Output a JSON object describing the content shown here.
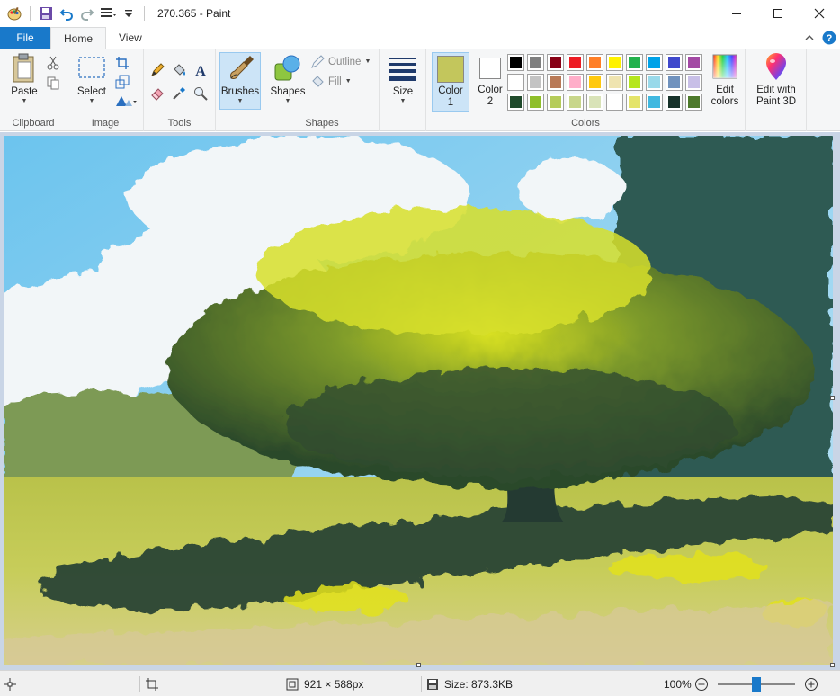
{
  "window": {
    "title": "270.365 - Paint"
  },
  "tabs": {
    "file": "File",
    "home": "Home",
    "view": "View"
  },
  "ribbon": {
    "clipboard": {
      "paste": "Paste",
      "group": "Clipboard"
    },
    "image": {
      "select": "Select",
      "group": "Image"
    },
    "tools": {
      "group": "Tools"
    },
    "shapes": {
      "shapes": "Shapes",
      "brushes": "Brushes",
      "outline": "Outline",
      "fill": "Fill",
      "group": "Shapes"
    },
    "size": {
      "label": "Size"
    },
    "colors": {
      "color1_line1": "Color",
      "color1_line2": "1",
      "color2_line1": "Color",
      "color2_line2": "2",
      "edit_line1": "Edit",
      "edit_line2": "colors",
      "group": "Colors",
      "color1_value": "#c3c65c",
      "color2_value": "#ffffff",
      "palette_row1": [
        "#000000",
        "#7f7f7f",
        "#880015",
        "#ed1c24",
        "#ff7f27",
        "#fff200",
        "#22b14c",
        "#00a2e8",
        "#3f48cc",
        "#a349a4"
      ],
      "palette_row2": [
        "#ffffff",
        "#c3c3c3",
        "#b97a57",
        "#ffaec9",
        "#ffc90e",
        "#efe4b0",
        "#b5e61d",
        "#99d9ea",
        "#7092be",
        "#c8bfe7"
      ],
      "palette_row3": [
        "#1f4a2b",
        "#8fbf2a",
        "#b5cc5a",
        "#c8d68a",
        "#d9e3b8",
        "#ffffff",
        "#e4e46a",
        "#40b8e0",
        "#17322a",
        "#4e7a2c"
      ]
    },
    "paint3d": {
      "line1": "Edit with",
      "line2": "Paint 3D"
    }
  },
  "status": {
    "dimensions": "921 × 588px",
    "size": "Size: 873.3KB",
    "zoom": "100%",
    "zoom_level": 0.5
  },
  "icons": {
    "app": "paint-app-icon",
    "save": "save-icon",
    "undo": "undo-icon",
    "redo": "redo-icon",
    "help": "help-icon"
  }
}
